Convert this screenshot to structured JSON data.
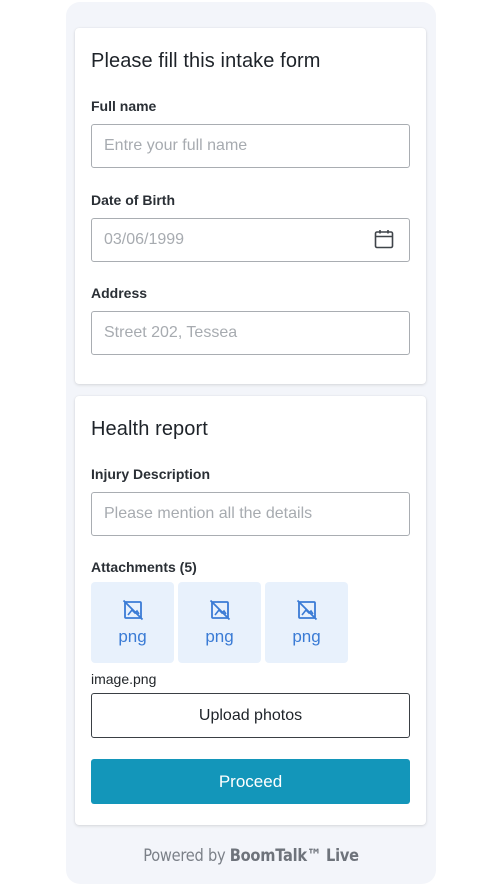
{
  "intake": {
    "title": "Please fill this intake form",
    "full_name_label": "Full name",
    "full_name_placeholder": "Entre your full name",
    "dob_label": "Date of Birth",
    "dob_placeholder": "03/06/1999",
    "address_label": "Address",
    "address_placeholder": "Street 202, Tessea"
  },
  "health": {
    "title": "Health report",
    "injury_label": "Injury Description",
    "injury_placeholder": "Please mention all the details",
    "attachments_label": "Attachments (5)",
    "attachments": [
      {
        "ext": "png",
        "icon": "broken-image-icon"
      },
      {
        "ext": "png",
        "icon": "broken-image-icon"
      },
      {
        "ext": "png",
        "icon": "broken-image-icon"
      }
    ],
    "filename": "image.png",
    "upload_label": "Upload photos",
    "proceed_label": "Proceed"
  },
  "footer": {
    "prefix": "Powered by ",
    "brand": "BoomTalk™ Live"
  },
  "colors": {
    "accent": "#1396ba",
    "attachment_bg": "#e8f1fc",
    "attachment_icon": "#3a7bd5",
    "frame_bg": "#f3f5fa"
  }
}
